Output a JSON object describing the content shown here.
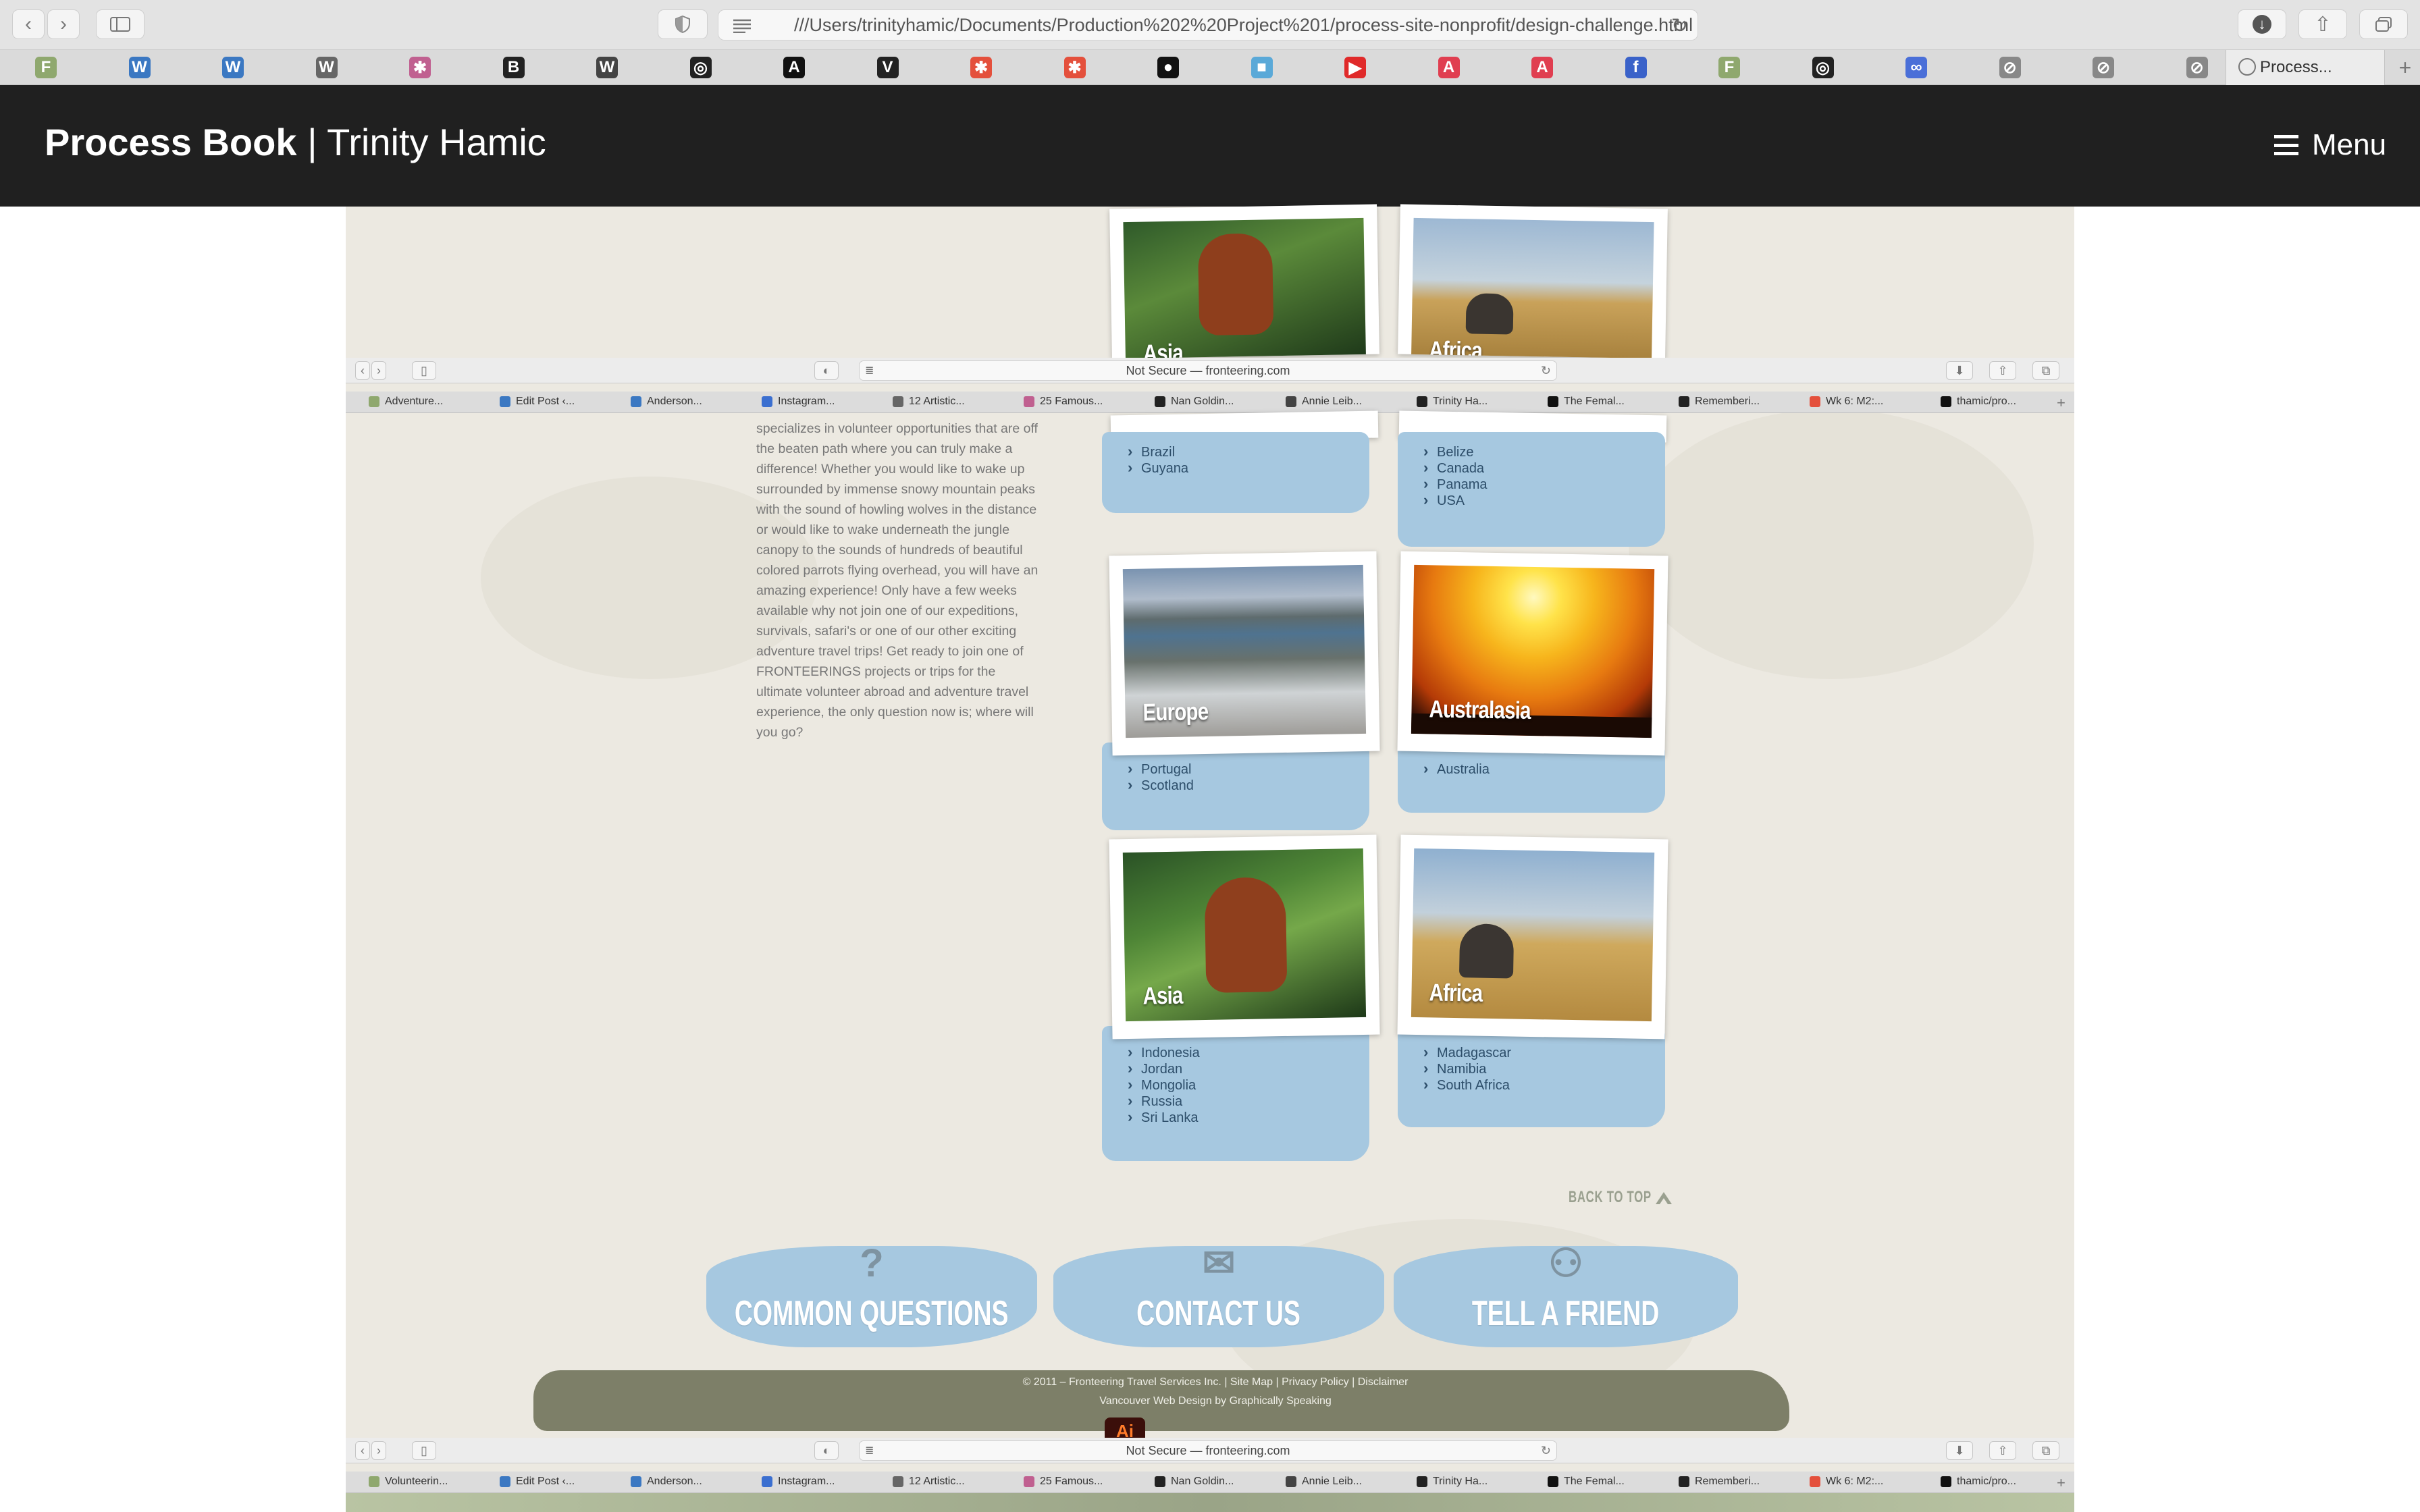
{
  "outer_browser": {
    "url": "///Users/trinityhamic/Documents/Production%202%20Project%201/process-site-nonprofit/design-challenge.html",
    "active_tab_label": "Process...",
    "favorites_icons": [
      "fronteering-icon",
      "wordpress-icon",
      "wordpress-icon",
      "w-icon",
      "colorwheel-icon",
      "b-icon",
      "wikipedia-icon",
      "instagram-icon",
      "a-icon",
      "v-icon",
      "asterisk-icon",
      "asterisk-icon",
      "github-icon",
      "blue-square-icon",
      "youtube-icon",
      "adobe-icon",
      "adobe-icon",
      "facebook-icon",
      "fronteering-icon",
      "instagram-icon",
      "link-icon",
      "compass-icon",
      "compass-icon",
      "compass-icon"
    ]
  },
  "process_book": {
    "title_bold": "Process Book",
    "title_sep": "|",
    "title_name": "Trinity Hamic",
    "menu_label": "Menu"
  },
  "inner_browser": {
    "url": "Not Secure — fronteering.com",
    "favorites_top": [
      "Adventure...",
      "Edit Post ‹...",
      "Anderson...",
      "Instagram...",
      "12 Artistic...",
      "25 Famous...",
      "Nan Goldin...",
      "Annie Leib...",
      "Trinity Ha...",
      "The Femal...",
      "Rememberi...",
      "Wk 6: M2:...",
      "thamic/pro..."
    ],
    "favorites_bottom": [
      "Volunteerin...",
      "Edit Post ‹...",
      "Anderson...",
      "Instagram...",
      "12 Artistic...",
      "25 Famous...",
      "Nan Goldin...",
      "Annie Leib...",
      "Trinity Ha...",
      "The Femal...",
      "Rememberi...",
      "Wk 6: M2:...",
      "thamic/pro..."
    ]
  },
  "site": {
    "intro": "specializes in volunteer opportunities that are off the beaten path where you can truly make a difference! Whether you would like to wake up surrounded by immense snowy mountain peaks with the sound of howling wolves in the distance or would like to wake underneath the jungle canopy to the sounds of hundreds of beautiful colored parrots flying overhead, you will have an amazing experience! Only have a few weeks available why not join one of our expeditions, survivals, safari's or one of our other exciting adventure travel trips! Get ready to join one of FRONTEERINGS projects or trips for the ultimate volunteer abroad and adventure travel experience, the only question now is; where will you go?",
    "top_regions": {
      "asia_label": "Asia",
      "africa_label": "Africa"
    },
    "americas_south": [
      "Brazil",
      "Guyana"
    ],
    "americas_north": [
      "Belize",
      "Canada",
      "Panama",
      "USA"
    ],
    "europe": {
      "label": "Europe",
      "countries": [
        "Portugal",
        "Scotland"
      ]
    },
    "australasia": {
      "label": "Australasia",
      "countries": [
        "Australia"
      ]
    },
    "asia": {
      "label": "Asia",
      "countries": [
        "Indonesia",
        "Jordan",
        "Mongolia",
        "Russia",
        "Sri Lanka"
      ]
    },
    "africa": {
      "label": "Africa",
      "countries": [
        "Madagascar",
        "Namibia",
        "South Africa"
      ]
    },
    "back_to_top": "BACK TO TOP",
    "footer_buttons": [
      "COMMON QUESTIONS",
      "CONTACT US",
      "TELL A FRIEND"
    ],
    "copyright": "© 2011 – Fronteering Travel Services Inc.  |  Site Map  |  Privacy Policy  |  Disclaimer",
    "credit": "Vancouver Web Design by Graphically Speaking"
  },
  "colors": {
    "header_bg": "#202020",
    "water_blue": "#a6c8e0",
    "site_bg": "#ece9e1"
  }
}
